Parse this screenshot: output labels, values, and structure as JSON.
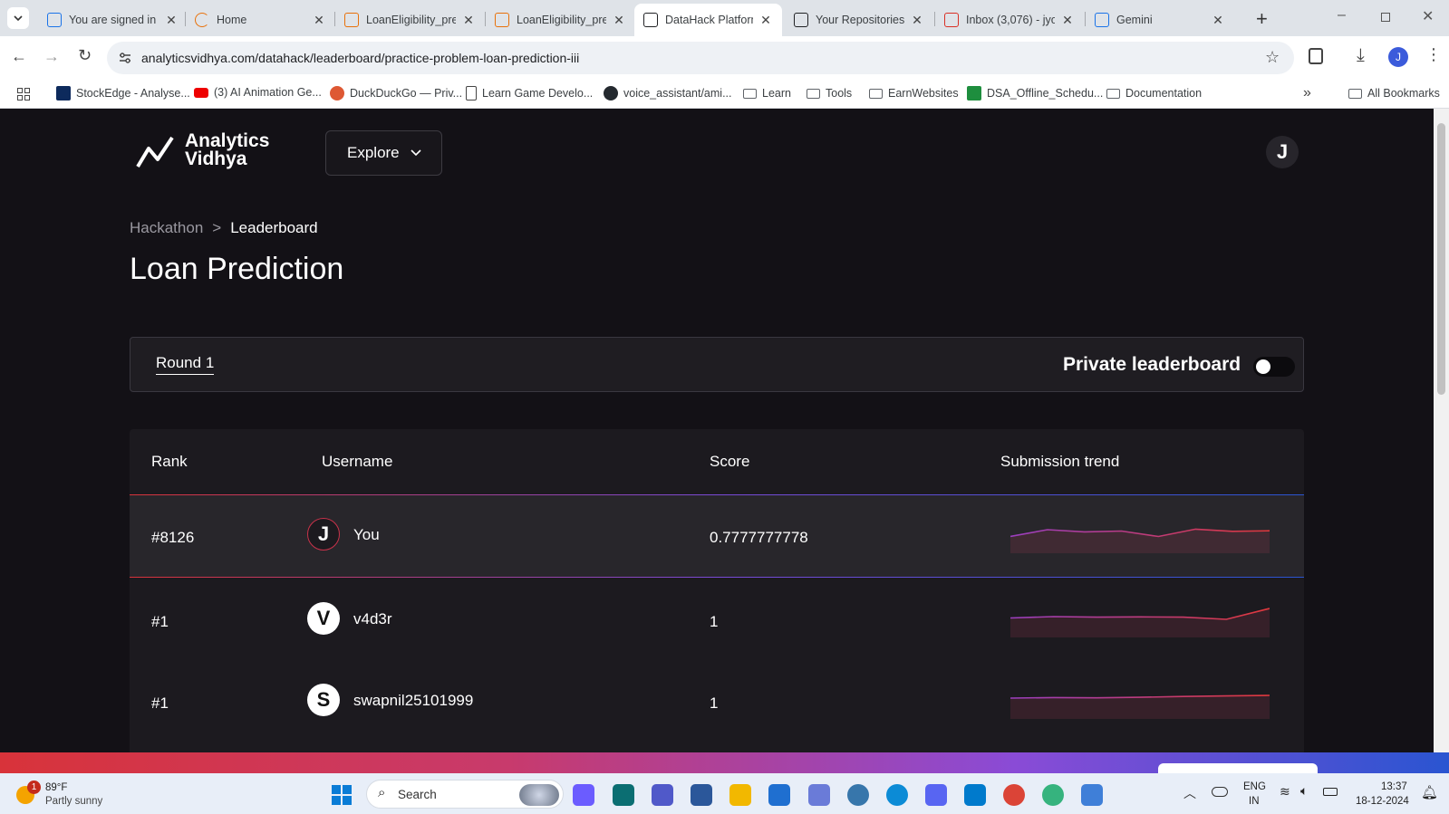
{
  "browser": {
    "tabs": [
      {
        "title": "You are signed in",
        "icon": "s-doc-icon",
        "color": "#1a73e8"
      },
      {
        "title": "Home",
        "icon": "loading-icon",
        "color": "#e8710a"
      },
      {
        "title": "LoanEligibility_pre",
        "icon": "notebook-icon",
        "color": "#e8710a"
      },
      {
        "title": "LoanEligibility_pre",
        "icon": "notebook-icon",
        "color": "#e8710a"
      },
      {
        "title": "DataHack Platform",
        "icon": "trend-icon",
        "color": "#202124"
      },
      {
        "title": "Your Repositories",
        "icon": "github-icon",
        "color": "#202124"
      },
      {
        "title": "Inbox (3,076) - jyo",
        "icon": "gmail-icon",
        "color": "#d93025"
      },
      {
        "title": "Gemini",
        "icon": "gemini-icon",
        "color": "#1a73e8"
      }
    ],
    "url": "analyticsvidhya.com/datahack/leaderboard/practice-problem-loan-prediction-iii",
    "bookmarks": [
      {
        "label": "StockEdge - Analyse...",
        "icon": "stockedge-icon"
      },
      {
        "label": "(3) AI Animation Ge...",
        "icon": "youtube-icon"
      },
      {
        "label": "DuckDuckGo — Priv...",
        "icon": "duckduckgo-icon"
      },
      {
        "label": "Learn Game Develo...",
        "icon": "page-icon"
      },
      {
        "label": "voice_assistant/ami...",
        "icon": "github-icon"
      },
      {
        "label": "Learn",
        "icon": "folder-icon"
      },
      {
        "label": "Tools",
        "icon": "folder-icon"
      },
      {
        "label": "EarnWebsites",
        "icon": "folder-icon"
      },
      {
        "label": "DSA_Offline_Schedu...",
        "icon": "sheets-icon"
      },
      {
        "label": "Documentation",
        "icon": "folder-icon"
      }
    ],
    "all_bookmarks": "All Bookmarks"
  },
  "site": {
    "logo_line1": "Analytics",
    "logo_line2": "Vidhya",
    "explore": "Explore",
    "user_initial": "J",
    "breadcrumb": {
      "parent": "Hackathon",
      "separator": ">",
      "current": "Leaderboard"
    },
    "title": "Loan Prediction",
    "round_tab": "Round 1",
    "private_toggle_label": "Private leaderboard",
    "private_toggle_on": false
  },
  "leaderboard": {
    "headers": [
      "Rank",
      "Username",
      "Score",
      "Submission trend"
    ],
    "rows": [
      {
        "rank": "#8126",
        "initial": "J",
        "username": "You",
        "score": "0.7777777778",
        "trend": [
          0.55,
          0.8,
          0.72,
          0.75,
          0.55,
          0.82,
          0.74,
          0.76
        ],
        "highlight": true
      },
      {
        "rank": "#1",
        "initial": "V",
        "username": "v4d3r",
        "score": "1",
        "trend": [
          0.65,
          0.7,
          0.68,
          0.69,
          0.68,
          0.6,
          1.0
        ],
        "highlight": false
      },
      {
        "rank": "#1",
        "initial": "S",
        "username": "swapnil25101999",
        "score": "1",
        "trend": [
          0.7,
          0.72,
          0.71,
          0.73,
          0.76,
          0.78,
          0.8
        ],
        "highlight": false
      }
    ]
  },
  "taskbar": {
    "weather_temp": "89°F",
    "weather_desc": "Partly sunny",
    "weather_badge": "1",
    "search_placeholder": "Search",
    "lang_line1": "ENG",
    "lang_line2": "IN",
    "time": "13:37",
    "date": "18-12-2024"
  }
}
